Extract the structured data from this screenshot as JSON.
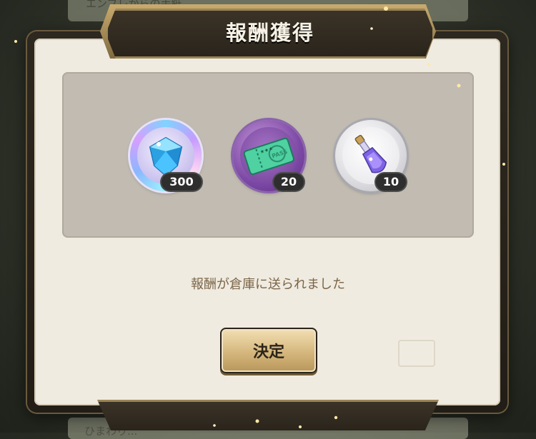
{
  "background": {
    "top_text": "エンブレからの手紙",
    "bottom_text": "ひまわり..."
  },
  "dialog": {
    "title": "報酬獲得",
    "message": "報酬が倉庫に送られました",
    "confirm_label": "決定"
  },
  "rewards": [
    {
      "name": "gem",
      "icon": "diamond-icon",
      "quantity": "300"
    },
    {
      "name": "pass-ticket",
      "icon": "ticket-icon",
      "quantity": "20"
    },
    {
      "name": "potion",
      "icon": "potion-icon",
      "quantity": "10"
    }
  ],
  "colors": {
    "title_plate": "#2a241b",
    "dialog_bg": "#f0ebe0",
    "reward_area": "#c1bbb1",
    "message_text": "#7a6548",
    "button_gold": "#d5b77d"
  }
}
